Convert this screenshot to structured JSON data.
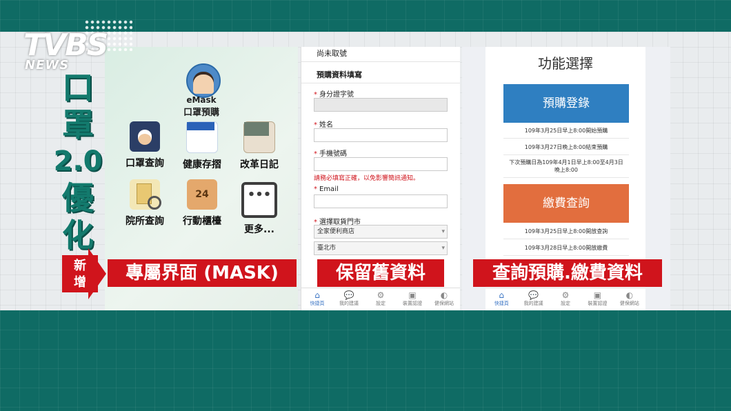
{
  "overlay": {
    "logo_main": "TVBS",
    "logo_sub": "NEWS",
    "vertical_title": [
      "口",
      "罩",
      "2.0",
      "優",
      "化"
    ],
    "new_badge": [
      "新",
      "增"
    ],
    "captions": [
      "專屬界面 (MASK)",
      "保留舊資料",
      "查詢預購.繳費資料"
    ]
  },
  "panel_home": {
    "app_title": "eMask",
    "app_subtitle": "口罩預購",
    "tiles": [
      {
        "label": "口罩查詢",
        "icon": "mask-face-icon"
      },
      {
        "label": "健康存摺",
        "icon": "health-book-icon"
      },
      {
        "label": "改革日記",
        "icon": "reform-diary-book-icon"
      },
      {
        "label": "院所查詢",
        "icon": "hospital-search-icon"
      },
      {
        "label": "行動櫃檯",
        "icon": "mobile-counter-24-icon",
        "badge": "24"
      },
      {
        "label": "更多...",
        "icon": "more-icon",
        "glyph": "•••"
      }
    ]
  },
  "panel_form": {
    "top_text": "尚未取號",
    "section_title": "預購資料填寫",
    "fields": [
      {
        "label": "身分證字號",
        "required": true
      },
      {
        "label": "姓名",
        "required": true
      },
      {
        "label": "手機號碼",
        "required": true
      },
      {
        "label": "Email",
        "required": true
      },
      {
        "label": "選擇取貨門市",
        "required": true
      }
    ],
    "phone_warning": "請務必填寫正確，以免影響簡訊通知。",
    "store_type": "全家便利商店",
    "city": "臺北市",
    "required_mark": "*"
  },
  "panel_function": {
    "title": "功能選擇",
    "preorder_button": "預購登錄",
    "preorder_info": [
      "109年3月25日早上8:00開始預購",
      "109年3月27日晚上8:00結束預購",
      "下次預購日為109年4月1日早上8:00至4月3日晚上8:00"
    ],
    "payment_button": "繳費查詢",
    "payment_info": [
      "109年3月25日早上8:00開放查詢",
      "109年3月28日早上8:00開放繳費"
    ],
    "colors": {
      "preorder": "#2f7fc1",
      "payment": "#e26e3e"
    }
  },
  "tabbar": [
    {
      "label": "快捷頁",
      "icon": "home-icon",
      "active": true
    },
    {
      "label": "我的建議",
      "icon": "chat-icon",
      "active": false
    },
    {
      "label": "設定",
      "icon": "gear-icon",
      "active": false
    },
    {
      "label": "裝置認證",
      "icon": "device-auth-icon",
      "active": false
    },
    {
      "label": "健保網站",
      "icon": "globe-icon",
      "active": false
    }
  ]
}
